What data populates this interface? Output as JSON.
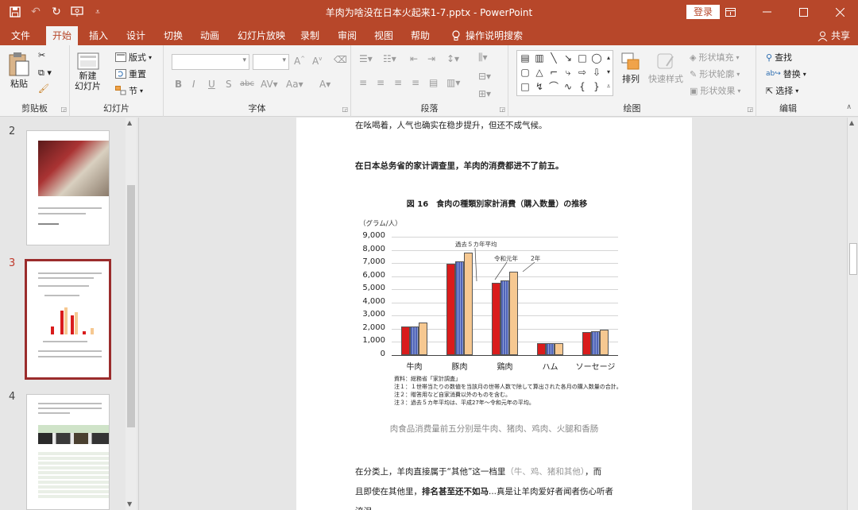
{
  "titlebar": {
    "title": "羊肉为啥没在日本火起来1-7.pptx  -  PowerPoint",
    "login": "登录",
    "quick_access": [
      "save-icon",
      "undo-icon",
      "redo-icon",
      "slideshow-from-start-icon",
      "customize-icon"
    ],
    "window_buttons": [
      "ribbon-display-icon",
      "minimize-icon",
      "maximize-icon",
      "close-icon"
    ]
  },
  "menu": {
    "tabs": [
      "文件",
      "开始",
      "插入",
      "设计",
      "切换",
      "动画",
      "幻灯片放映",
      "录制",
      "审阅",
      "视图",
      "帮助",
      "操作说明搜索"
    ],
    "active_tab": "开始",
    "share": "共享"
  },
  "ribbon": {
    "clipboard": {
      "label": "剪贴板",
      "paste": "粘贴"
    },
    "slides": {
      "label": "幻灯片",
      "new_slide": "新建\n幻灯片",
      "layout": "版式",
      "reset": "重置",
      "section": "节"
    },
    "font": {
      "label": "字体"
    },
    "paragraph": {
      "label": "段落"
    },
    "drawing": {
      "label": "绘图",
      "arrange": "排列",
      "quick_styles": "快速样式",
      "shape_fill": "形状填充",
      "shape_outline": "形状轮廓",
      "shape_effects": "形状效果"
    },
    "editing": {
      "label": "编辑",
      "find": "查找",
      "replace": "替换",
      "select": "选择"
    }
  },
  "thumbnails": [
    {
      "num": "2",
      "active": false
    },
    {
      "num": "3",
      "active": true
    },
    {
      "num": "4",
      "active": false
    }
  ],
  "slide": {
    "line1": "在吆喝着，人气也确实在稳步提升，但还不成气候。",
    "line2": "在日本总务省的家计调查里，羊肉的消费都进不了前五。",
    "caption": "肉食品消费量前五分别是牛肉、猪肉、鸡肉、火腿和香肠",
    "line3_a": "在分类上，羊肉直接属于“其他”这一档里",
    "line3_b": "（牛、鸡、猪和其他）",
    "line3_c": "，而",
    "line4_a": "且即使在其他里，",
    "line4_b": "排名甚至还不如马",
    "line4_c": "...真是让羊肉爱好者闻者伤心听者",
    "line5": "流泪"
  },
  "chart_data": {
    "type": "bar",
    "title": "図 16　食肉の種類別家計消費（購入数量）の推移",
    "ylabel": "（グラム/人）",
    "ylim": [
      0,
      9000
    ],
    "yticks": [
      "9,000",
      "8,000",
      "7,000",
      "6,000",
      "5,000",
      "4,000",
      "3,000",
      "2,000",
      "1,000",
      "0"
    ],
    "categories": [
      "牛肉",
      "豚肉",
      "鶏肉",
      "ハム",
      "ソーセージ"
    ],
    "series": [
      {
        "name": "過去５カ年平均",
        "values": [
          2150,
          6950,
          5500,
          900,
          1750
        ]
      },
      {
        "name": "令和元年",
        "values": [
          2200,
          7150,
          5700,
          900,
          1800
        ]
      },
      {
        "name": "2年",
        "values": [
          2450,
          7800,
          6350,
          900,
          1950
        ]
      }
    ],
    "colors": [
      "#d91c1c",
      "#8fa0d8",
      "#f6c891"
    ],
    "notes": [
      "資料：総務省「家計調査」",
      "注１：１世帯当たりの数値を当該月の世帯人数で除して算出された各月の購入数量の合計。",
      "注２：贈答用など自家消費以外のものを含む。",
      "注３：過去５カ年平均は、平成27年〜令和元年の平均。"
    ]
  }
}
